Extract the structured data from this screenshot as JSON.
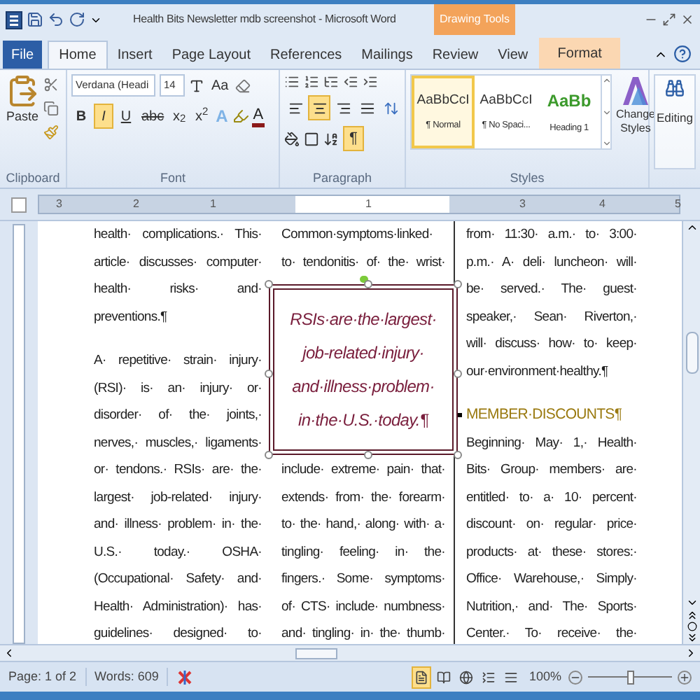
{
  "window": {
    "title": "Health Bits Newsletter mdb screenshot - Microsoft Word",
    "context_tab": "Drawing Tools"
  },
  "tabs": [
    {
      "label": "File",
      "kind": "file",
      "selected": false
    },
    {
      "label": "Home",
      "kind": "tab",
      "selected": true
    },
    {
      "label": "Insert",
      "kind": "tab",
      "selected": false
    },
    {
      "label": "Page Layout",
      "kind": "tab",
      "selected": false
    },
    {
      "label": "References",
      "kind": "tab",
      "selected": false
    },
    {
      "label": "Mailings",
      "kind": "tab",
      "selected": false
    },
    {
      "label": "Review",
      "kind": "tab",
      "selected": false
    },
    {
      "label": "View",
      "kind": "tab",
      "selected": false
    },
    {
      "label": "Format",
      "kind": "context",
      "selected": false
    }
  ],
  "ribbon": {
    "clipboard": {
      "label": "Clipboard",
      "paste": "Paste"
    },
    "font": {
      "label": "Font",
      "font_name": "Verdana (Headi",
      "font_size": "14",
      "change_case": "Aa",
      "format_buttons": [
        {
          "label": "B",
          "selected": false
        },
        {
          "label": "I",
          "selected": true
        },
        {
          "label": "U",
          "selected": false
        },
        {
          "label": "abc",
          "selected": false
        },
        {
          "label": "x$_{2}$",
          "selected": false
        },
        {
          "label": "x$^{2}$",
          "selected": false
        }
      ],
      "text_effects": "A",
      "font_color": "A"
    },
    "paragraph": {
      "label": "Paragraph",
      "align_buttons": [
        {
          "selected": false
        },
        {
          "selected": true
        },
        {
          "selected": false
        },
        {
          "selected": false
        }
      ],
      "show_marks": {
        "label": "¶",
        "selected": true
      }
    },
    "styles": {
      "label": "Styles",
      "items": [
        {
          "preview": "AaBbCcI",
          "name": "¶ Normal",
          "kind": "body",
          "selected": true
        },
        {
          "preview": "AaBbCcI",
          "name": "¶ No Spaci...",
          "kind": "body",
          "selected": false
        },
        {
          "preview": "AaBb",
          "name": "Heading 1",
          "kind": "heading",
          "selected": false
        }
      ]
    },
    "change_styles": "Change Styles",
    "editing": "Editing"
  },
  "ruler_labels": [
    "3",
    "2",
    "1",
    "1",
    "3",
    "4",
    "5"
  ],
  "columns": [
    {
      "blocks": [
        {
          "kind": "paragraph",
          "complete": true,
          "lines": [
            "health· complications.· This·",
            "article· discusses· computer·",
            "health·  risks·  and·",
            "preventions.¶"
          ]
        },
        {
          "kind": "paragraph",
          "complete": false,
          "lines": [
            "A· repetitive· strain· injury·",
            "(RSI)· is· an· injury· or·",
            "disorder· of· the· joints,·",
            "nerves,· muscles,· ligaments·",
            "or· tendons.· RSIs· are· the·",
            "largest· job-related· injury·",
            "and· illness· problem· in· the·",
            "U.S.·  today.·  OSHA·",
            "(Occupational· Safety· and·",
            "Health· Administration)· has·",
            "guidelines· designed· to·"
          ]
        }
      ]
    },
    {
      "blocks": [
        {
          "kind": "paragraph",
          "complete": false,
          "lines": [
            "Common·symptoms·linked·",
            "to· tendonitis· of· the· wrist·"
          ]
        },
        {
          "kind": "textbox",
          "lines": [
            "RSIs·are·the·largest·",
            "job-related·injury·",
            "and·illness·problem·",
            "in·the·U.S.·today.¶"
          ]
        },
        {
          "kind": "paragraph",
          "complete": false,
          "lines": [
            "include· extreme· pain· that·",
            "extends· from· the· forearm·",
            "to· the· hand,· along· with· a·",
            "tingling·  feeling·  in·  the·",
            "fingers.· Some· symptoms·",
            "of· CTS· include· numbness·",
            "and· tingling· in· the· thumb·"
          ]
        }
      ]
    },
    {
      "blocks": [
        {
          "kind": "paragraph",
          "complete": true,
          "lines": [
            "from· 11:30· a.m.· to· 3:00·",
            "p.m.· A· deli· luncheon· will·",
            "be· served.· The· guest·",
            "speaker,· Sean· Riverton,·",
            "will· discuss· how· to· keep·",
            "our·environment·healthy.¶"
          ]
        },
        {
          "kind": "heading",
          "lines": [
            "MEMBER·DISCOUNTS¶"
          ]
        },
        {
          "kind": "paragraph",
          "complete": false,
          "lines": [
            "Beginning· May· 1,· Health·",
            "Bits· Group· members· are·",
            "entitled· to· a· 10· percent·",
            "discount· on· regular· price·",
            "products· at· these· stores:·",
            "Office· Warehouse,· Simply·",
            "Nutrition,· and· The· Sports·",
            "Center.· To· receive· the·"
          ]
        }
      ]
    }
  ],
  "status_bar": {
    "page": "Page: 1 of 2",
    "words": "Words: 609",
    "views": [
      {
        "selected": true
      },
      {
        "selected": false
      },
      {
        "selected": false
      },
      {
        "selected": false
      },
      {
        "selected": false
      }
    ],
    "zoom": "100%",
    "zoom_slider": {
      "level": 0.5
    }
  }
}
